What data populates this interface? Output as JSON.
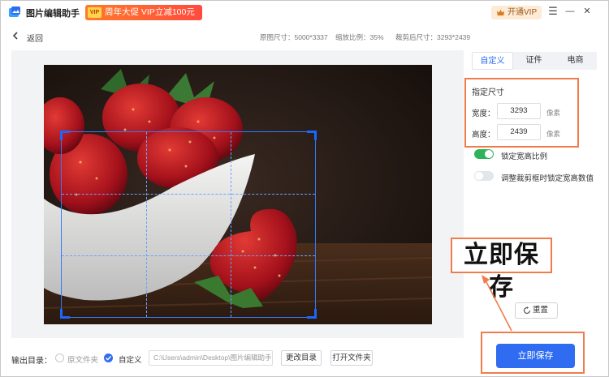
{
  "app": {
    "title": "图片编辑助手",
    "promo_badge": "VIP",
    "promo_text": "周年大促 VIP立减100元",
    "vip_button": "开通VIP",
    "controls": {
      "menu": "☰",
      "minimize": "—",
      "close": "✕"
    }
  },
  "header": {
    "back_label": "返回",
    "original_size": "原图尺寸：5000*3337",
    "scale": "缩放比例：35%",
    "crop_size": "裁剪后尺寸：3293*2439"
  },
  "panel": {
    "tabs": [
      {
        "label": "自定义",
        "active": true
      },
      {
        "label": "证件",
        "active": false
      },
      {
        "label": "电商",
        "active": false
      }
    ],
    "size_title": "指定尺寸",
    "width_label": "宽度：",
    "width_value": "3293",
    "height_label": "高度：",
    "height_value": "2439",
    "unit": "像素",
    "lock_ratio": {
      "label": "锁定宽高比例",
      "on": true
    },
    "lock_values": {
      "label": "调整裁剪框时锁定宽高数值",
      "on": false
    },
    "reset_label": "重置"
  },
  "annotation": {
    "text": "立即保存"
  },
  "footer": {
    "output_label": "输出目录：",
    "option_original": "原文件夹",
    "option_custom": "自定义",
    "selected": "自定义",
    "path": "C:\\Users\\admin\\Desktop\\图片编辑助手",
    "change_dir": "更改目录",
    "open_dir": "打开文件夹",
    "save_button": "立即保存"
  },
  "colors": {
    "accent": "#2f6cf2",
    "annotation": "#ef7c4a",
    "toggle_on": "#2fb35a",
    "promo": "#ff5a32"
  }
}
